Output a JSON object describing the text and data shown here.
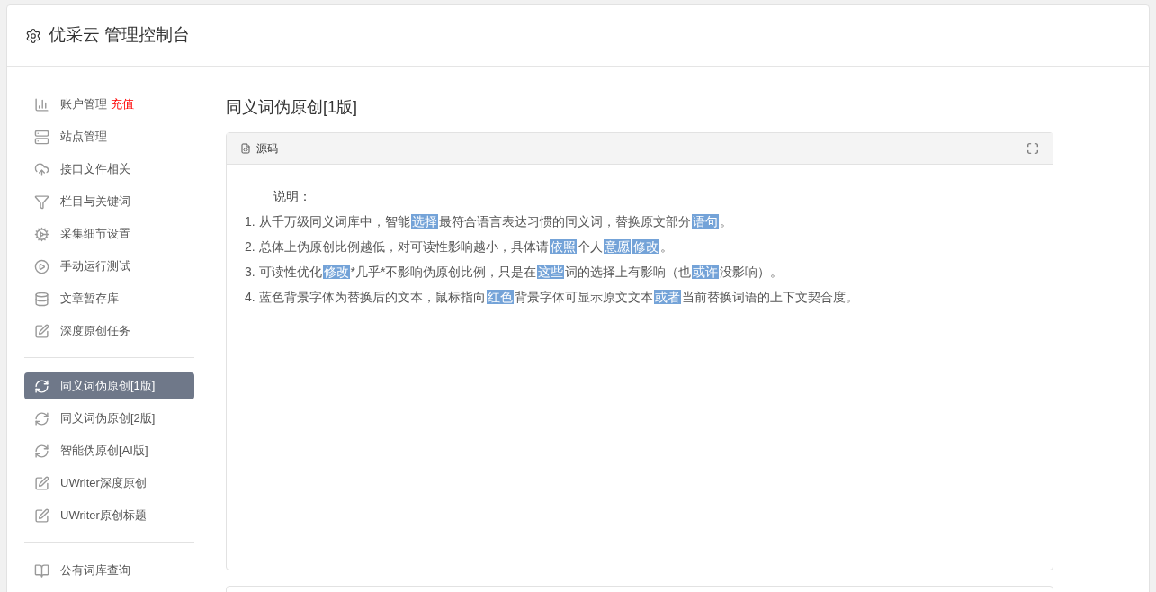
{
  "header": {
    "title": "优采云 管理控制台"
  },
  "sidebar": {
    "groups": [
      {
        "items": [
          {
            "label": "账户管理",
            "badge": "充值",
            "selected": false
          },
          {
            "label": "站点管理",
            "selected": false
          },
          {
            "label": "接口文件相关",
            "selected": false
          },
          {
            "label": "栏目与关键词",
            "selected": false
          },
          {
            "label": "采集细节设置",
            "selected": false
          },
          {
            "label": "手动运行测试",
            "selected": false
          },
          {
            "label": "文章暂存库",
            "selected": false
          },
          {
            "label": "深度原创任务",
            "selected": false
          }
        ]
      },
      {
        "items": [
          {
            "label": "同义词伪原创[1版]",
            "selected": true
          },
          {
            "label": "同义词伪原创[2版]",
            "selected": false
          },
          {
            "label": "智能伪原创[AI版]",
            "selected": false
          },
          {
            "label": "UWriter深度原创",
            "selected": false
          },
          {
            "label": "UWriter原创标题",
            "selected": false
          }
        ]
      },
      {
        "items": [
          {
            "label": "公有词库查询",
            "selected": false
          }
        ]
      }
    ]
  },
  "main": {
    "title": "同义词伪原创[1版]",
    "panel": {
      "tab": "源码",
      "heading": "说明：",
      "lines": [
        [
          {
            "text": "1. 从千万级同义词库中，智能",
            "highlighted": false
          },
          {
            "text": "选择",
            "highlighted": true
          },
          {
            "text": "最符合语言表达习惯的同义词，替换原文部分",
            "highlighted": false
          },
          {
            "text": "语句",
            "highlighted": true
          },
          {
            "text": "。",
            "highlighted": false
          }
        ],
        [
          {
            "text": "2. 总体上伪原创比例越低，对可读性影响越小，具体请",
            "highlighted": false
          },
          {
            "text": "依照",
            "highlighted": true
          },
          {
            "text": "个人",
            "highlighted": false
          },
          {
            "text": "意愿",
            "highlighted": true
          },
          {
            "text": "修改",
            "highlighted": true
          },
          {
            "text": "。",
            "highlighted": false
          }
        ],
        [
          {
            "text": "3. 可读性优化",
            "highlighted": false
          },
          {
            "text": "修改",
            "highlighted": true
          },
          {
            "text": "*几乎*不影响伪原创比例，只是在",
            "highlighted": false
          },
          {
            "text": "这些",
            "highlighted": true
          },
          {
            "text": "词的选择上有影响（也",
            "highlighted": false
          },
          {
            "text": "或许",
            "highlighted": true
          },
          {
            "text": "没影响）。",
            "highlighted": false
          }
        ],
        [
          {
            "text": "4. 蓝色背景字体为替换后的文本，鼠标指向",
            "highlighted": false
          },
          {
            "text": "红色",
            "highlighted": true
          },
          {
            "text": "背景字体可显示原文文本",
            "highlighted": false
          },
          {
            "text": "或者",
            "highlighted": true
          },
          {
            "text": "当前替换词语的上下文契合度。",
            "highlighted": false
          }
        ]
      ]
    }
  }
}
